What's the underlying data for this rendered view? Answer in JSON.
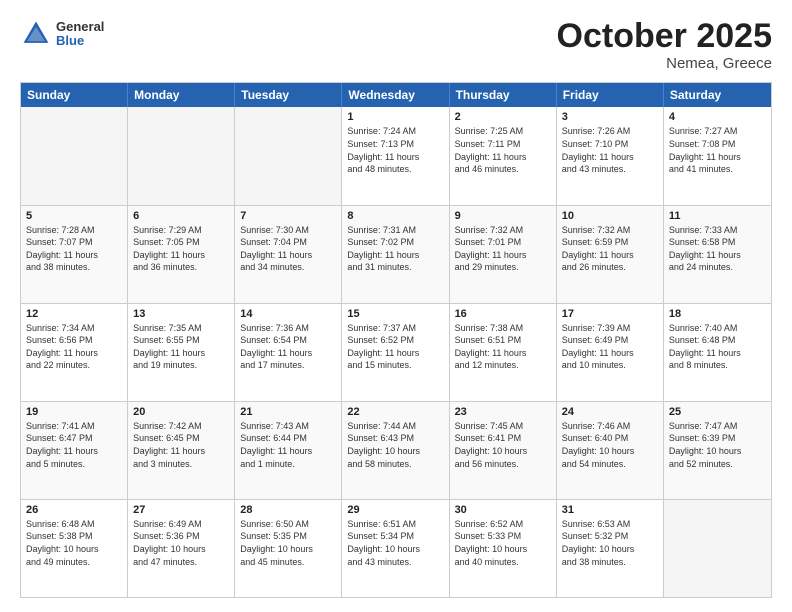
{
  "header": {
    "logo_general": "General",
    "logo_blue": "Blue",
    "title": "October 2025",
    "subtitle": "Nemea, Greece"
  },
  "weekdays": [
    "Sunday",
    "Monday",
    "Tuesday",
    "Wednesday",
    "Thursday",
    "Friday",
    "Saturday"
  ],
  "rows": [
    [
      {
        "day": "",
        "info": "",
        "empty": true
      },
      {
        "day": "",
        "info": "",
        "empty": true
      },
      {
        "day": "",
        "info": "",
        "empty": true
      },
      {
        "day": "1",
        "info": "Sunrise: 7:24 AM\nSunset: 7:13 PM\nDaylight: 11 hours\nand 48 minutes."
      },
      {
        "day": "2",
        "info": "Sunrise: 7:25 AM\nSunset: 7:11 PM\nDaylight: 11 hours\nand 46 minutes."
      },
      {
        "day": "3",
        "info": "Sunrise: 7:26 AM\nSunset: 7:10 PM\nDaylight: 11 hours\nand 43 minutes."
      },
      {
        "day": "4",
        "info": "Sunrise: 7:27 AM\nSunset: 7:08 PM\nDaylight: 11 hours\nand 41 minutes."
      }
    ],
    [
      {
        "day": "5",
        "info": "Sunrise: 7:28 AM\nSunset: 7:07 PM\nDaylight: 11 hours\nand 38 minutes."
      },
      {
        "day": "6",
        "info": "Sunrise: 7:29 AM\nSunset: 7:05 PM\nDaylight: 11 hours\nand 36 minutes."
      },
      {
        "day": "7",
        "info": "Sunrise: 7:30 AM\nSunset: 7:04 PM\nDaylight: 11 hours\nand 34 minutes."
      },
      {
        "day": "8",
        "info": "Sunrise: 7:31 AM\nSunset: 7:02 PM\nDaylight: 11 hours\nand 31 minutes."
      },
      {
        "day": "9",
        "info": "Sunrise: 7:32 AM\nSunset: 7:01 PM\nDaylight: 11 hours\nand 29 minutes."
      },
      {
        "day": "10",
        "info": "Sunrise: 7:32 AM\nSunset: 6:59 PM\nDaylight: 11 hours\nand 26 minutes."
      },
      {
        "day": "11",
        "info": "Sunrise: 7:33 AM\nSunset: 6:58 PM\nDaylight: 11 hours\nand 24 minutes."
      }
    ],
    [
      {
        "day": "12",
        "info": "Sunrise: 7:34 AM\nSunset: 6:56 PM\nDaylight: 11 hours\nand 22 minutes."
      },
      {
        "day": "13",
        "info": "Sunrise: 7:35 AM\nSunset: 6:55 PM\nDaylight: 11 hours\nand 19 minutes."
      },
      {
        "day": "14",
        "info": "Sunrise: 7:36 AM\nSunset: 6:54 PM\nDaylight: 11 hours\nand 17 minutes."
      },
      {
        "day": "15",
        "info": "Sunrise: 7:37 AM\nSunset: 6:52 PM\nDaylight: 11 hours\nand 15 minutes."
      },
      {
        "day": "16",
        "info": "Sunrise: 7:38 AM\nSunset: 6:51 PM\nDaylight: 11 hours\nand 12 minutes."
      },
      {
        "day": "17",
        "info": "Sunrise: 7:39 AM\nSunset: 6:49 PM\nDaylight: 11 hours\nand 10 minutes."
      },
      {
        "day": "18",
        "info": "Sunrise: 7:40 AM\nSunset: 6:48 PM\nDaylight: 11 hours\nand 8 minutes."
      }
    ],
    [
      {
        "day": "19",
        "info": "Sunrise: 7:41 AM\nSunset: 6:47 PM\nDaylight: 11 hours\nand 5 minutes."
      },
      {
        "day": "20",
        "info": "Sunrise: 7:42 AM\nSunset: 6:45 PM\nDaylight: 11 hours\nand 3 minutes."
      },
      {
        "day": "21",
        "info": "Sunrise: 7:43 AM\nSunset: 6:44 PM\nDaylight: 11 hours\nand 1 minute."
      },
      {
        "day": "22",
        "info": "Sunrise: 7:44 AM\nSunset: 6:43 PM\nDaylight: 10 hours\nand 58 minutes."
      },
      {
        "day": "23",
        "info": "Sunrise: 7:45 AM\nSunset: 6:41 PM\nDaylight: 10 hours\nand 56 minutes."
      },
      {
        "day": "24",
        "info": "Sunrise: 7:46 AM\nSunset: 6:40 PM\nDaylight: 10 hours\nand 54 minutes."
      },
      {
        "day": "25",
        "info": "Sunrise: 7:47 AM\nSunset: 6:39 PM\nDaylight: 10 hours\nand 52 minutes."
      }
    ],
    [
      {
        "day": "26",
        "info": "Sunrise: 6:48 AM\nSunset: 5:38 PM\nDaylight: 10 hours\nand 49 minutes."
      },
      {
        "day": "27",
        "info": "Sunrise: 6:49 AM\nSunset: 5:36 PM\nDaylight: 10 hours\nand 47 minutes."
      },
      {
        "day": "28",
        "info": "Sunrise: 6:50 AM\nSunset: 5:35 PM\nDaylight: 10 hours\nand 45 minutes."
      },
      {
        "day": "29",
        "info": "Sunrise: 6:51 AM\nSunset: 5:34 PM\nDaylight: 10 hours\nand 43 minutes."
      },
      {
        "day": "30",
        "info": "Sunrise: 6:52 AM\nSunset: 5:33 PM\nDaylight: 10 hours\nand 40 minutes."
      },
      {
        "day": "31",
        "info": "Sunrise: 6:53 AM\nSunset: 5:32 PM\nDaylight: 10 hours\nand 38 minutes."
      },
      {
        "day": "",
        "info": "",
        "empty": true
      }
    ]
  ]
}
